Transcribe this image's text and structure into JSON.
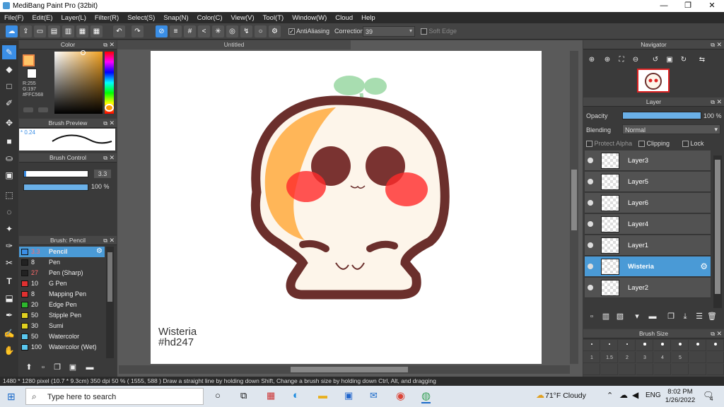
{
  "window": {
    "title": "MediBang Paint Pro (32bit)",
    "min": "—",
    "max": "❐",
    "close": "✕"
  },
  "menu": [
    "File(F)",
    "Edit(E)",
    "Layer(L)",
    "Filter(R)",
    "Select(S)",
    "Snap(N)",
    "Color(C)",
    "View(V)",
    "Tool(T)",
    "Window(W)",
    "Cloud",
    "Help"
  ],
  "toolbar": {
    "antialiasing": "AntiAliasing",
    "correction_label": "Correction",
    "correction_value": "39",
    "soft_edge": "Soft Edge"
  },
  "color_panel": {
    "title": "Color",
    "r": "R:255",
    "g": "G:197",
    "hex": "#FFC568",
    "primary": "#ffc568"
  },
  "brush_preview": {
    "title": "Brush Preview",
    "size": "0.24"
  },
  "brush_control": {
    "title": "Brush Control",
    "size": "3.3",
    "opacity": "100 %"
  },
  "brush_panel": {
    "title": "Brush: Pencil",
    "items": [
      {
        "size": "3.3",
        "name": "Pencil",
        "color": "#3a8ee6",
        "size_color": "#ff6a6a"
      },
      {
        "size": "8",
        "name": "Pen",
        "color": "#222222",
        "size_color": "#eeeeee"
      },
      {
        "size": "27",
        "name": "Pen (Sharp)",
        "color": "#222222",
        "size_color": "#ff6a6a"
      },
      {
        "size": "10",
        "name": "G Pen",
        "color": "#e03030",
        "size_color": "#eeeeee"
      },
      {
        "size": "8",
        "name": "Mapping Pen",
        "color": "#e03030",
        "size_color": "#eeeeee"
      },
      {
        "size": "20",
        "name": "Edge Pen",
        "color": "#2db82d",
        "size_color": "#eeeeee"
      },
      {
        "size": "50",
        "name": "Stipple Pen",
        "color": "#e0d020",
        "size_color": "#eeeeee"
      },
      {
        "size": "30",
        "name": "Sumi",
        "color": "#e0d020",
        "size_color": "#eeeeee"
      },
      {
        "size": "50",
        "name": "Watercolor",
        "color": "#5ac8f0",
        "size_color": "#eeeeee"
      },
      {
        "size": "100",
        "name": "Watercolor (Wet)",
        "color": "#5ac8f0",
        "size_color": "#eeeeee"
      }
    ]
  },
  "canvas": {
    "tab": "Untitled",
    "watermark_line1": "Wisteria",
    "watermark_line2": "#hd247"
  },
  "navigator": {
    "title": "Navigator"
  },
  "layer_panel": {
    "title": "Layer",
    "opacity_label": "Opacity",
    "opacity_value": "100 %",
    "blending_label": "Blending",
    "blending_value": "Normal",
    "protect_alpha": "Protect Alpha",
    "clipping": "Clipping",
    "lock": "Lock",
    "layers": [
      "Layer3",
      "Layer5",
      "Layer6",
      "Layer4",
      "Layer1",
      "Wisteria",
      "Layer2"
    ]
  },
  "brush_size": {
    "title": "Brush Size",
    "labels": [
      "1",
      "1.5",
      "2",
      "3",
      "4",
      "5"
    ]
  },
  "status": {
    "text": "1480 * 1280 pixel   (10.7 * 9.3cm)   350 dpi   50 %   ( 1555, 588 )   Draw a straight line by holding down Shift, Change a brush size by holding down Ctrl, Alt, and dragging"
  },
  "taskbar": {
    "search_placeholder": "Type here to search",
    "weather": "71°F  Cloudy",
    "lang": "ENG",
    "time": "8:02 PM",
    "date": "1/26/2022",
    "notif": "4"
  }
}
